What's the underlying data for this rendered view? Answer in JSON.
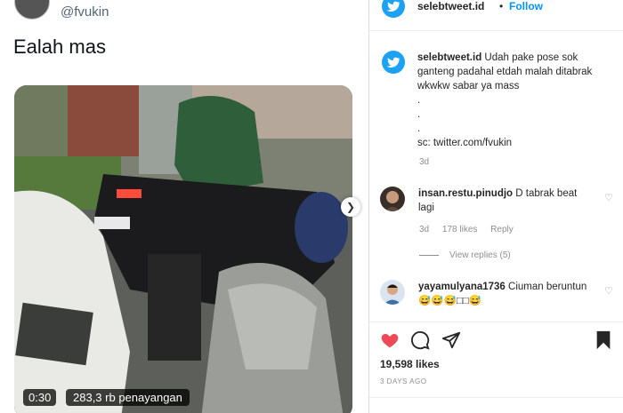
{
  "tweet": {
    "handle": "@fvukin",
    "text": "Ealah mas",
    "video_time": "0:30",
    "video_views": "283,3 rb penayangan"
  },
  "post": {
    "username": "selebtweet.id",
    "separator": "•",
    "follow_label": "Follow",
    "caption_username": "selebtweet.id",
    "caption_lines": [
      "Udah pake pose sok ganteng padahal etdah malah ditabrak wkwkw sabar ya mass",
      ".",
      ".",
      ".",
      "sc: twitter.com/fvukin"
    ],
    "caption_age": "3d",
    "comments": [
      {
        "username": "insan.restu.pinudjo",
        "text": "D tabrak beat lagi",
        "age": "3d",
        "likes": "178 likes",
        "reply_label": "Reply",
        "view_replies": "View replies (5)"
      },
      {
        "username": "yayamulyana1736",
        "text": "Ciuman beruntun😅😅😅□□😅"
      }
    ],
    "likes_count": "19,598 likes",
    "date": "3 DAYS AGO"
  },
  "icons": {
    "like": "heart-icon",
    "comment": "comment-icon",
    "share": "paper-plane-icon",
    "save": "bookmark-icon",
    "next": "chevron-right-icon"
  },
  "colors": {
    "like_red": "#ed4956",
    "follow_blue": "#0095f6",
    "twitter_blue": "#1da1f2"
  }
}
